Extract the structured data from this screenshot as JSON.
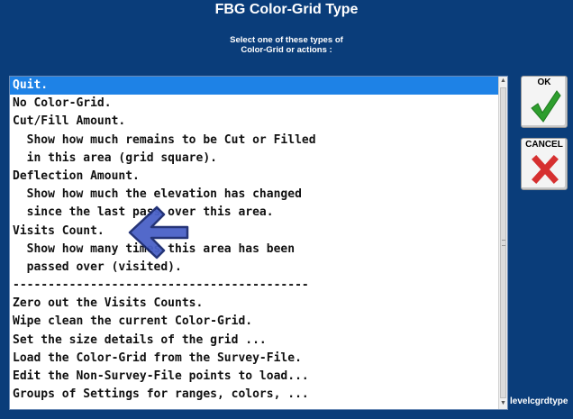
{
  "dialog": {
    "title": "FBG Color-Grid Type",
    "subtitle_line1": "Select one of these types of",
    "subtitle_line2": "Color-Grid or actions :"
  },
  "list": {
    "items": [
      "Quit.",
      "No Color-Grid.",
      "Cut/Fill Amount.",
      "  Show how much remains to be Cut or Filled",
      "  in this area (grid square).",
      "Deflection Amount.",
      "  Show how much the elevation has changed",
      "  since the last pass over this area.",
      "Visits Count.",
      "  Show how many times this area has been",
      "  passed over (visited).",
      "------------------------------------------",
      "Zero out the Visits Counts.",
      "Wipe clean the current Color-Grid.",
      "Set the size details of the grid ...",
      "Load the Color-Grid from the Survey-File.",
      "Edit the Non-Survey-File points to load...",
      "Groups of Settings for ranges, colors, ..."
    ],
    "selected_index": 0
  },
  "buttons": {
    "ok_label": "OK",
    "cancel_label": "CANCEL"
  },
  "footer": {
    "label": "levelcgrdtype"
  },
  "colors": {
    "background": "#0a3d7a",
    "selection": "#1e82e6",
    "ok_check": "#2e9e2e",
    "cancel_x": "#d63030",
    "pointer_arrow": "#4a62c8"
  },
  "icons": [
    "checkmark-icon",
    "x-mark-icon",
    "pointer-arrow-icon",
    "scroll-up-icon",
    "scroll-down-icon"
  ]
}
